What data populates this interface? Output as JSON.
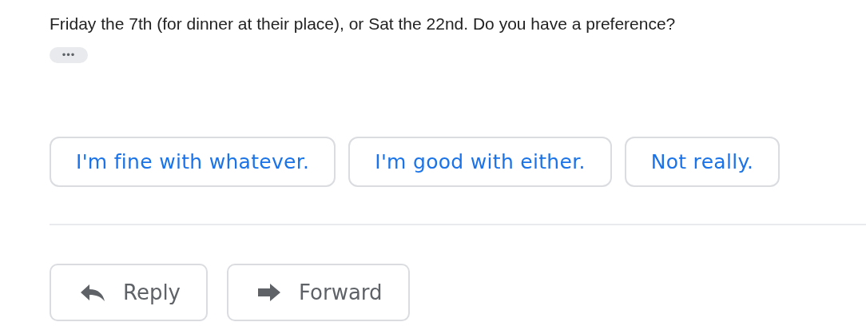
{
  "message": {
    "lines": [
      "Friday the 7th (for dinner at their place), or Sat the 22nd. Do you have a preference?"
    ],
    "show_trimmed": "•••"
  },
  "smart_replies": [
    "I'm fine with whatever.",
    "I'm good with either.",
    "Not really."
  ],
  "actions": [
    {
      "kind": "reply",
      "label": "Reply"
    },
    {
      "kind": "forward",
      "label": "Forward"
    }
  ]
}
